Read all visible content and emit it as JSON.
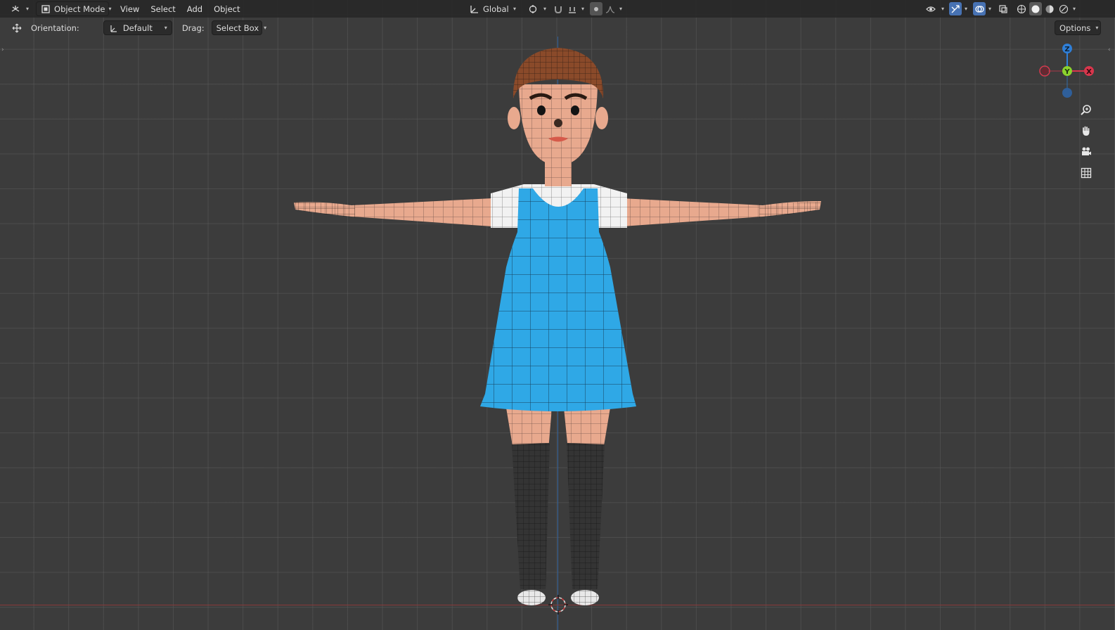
{
  "header": {
    "editor_type_icon": "viewport-editor-icon",
    "mode": "Object Mode",
    "menus": [
      "View",
      "Select",
      "Add",
      "Object"
    ],
    "transform_orientation": "Global",
    "pivot_icon": "pivot-point-icon",
    "snap_icon": "snap-magnet-icon",
    "proportional_icon": "proportional-edit-icon",
    "visibility_icon": "eye-visibility-icon",
    "gizmo_toggle_icon": "gizmo-toggle-icon",
    "overlay_icon": "overlay-icon",
    "xray_icon": "xray-toggle-icon",
    "shading_modes": [
      "wireframe",
      "solid",
      "material",
      "rendered"
    ],
    "active_shading": "solid"
  },
  "tool_settings": {
    "orientation_label": "Orientation:",
    "orientation_value": "Default",
    "drag_label": "Drag:",
    "drag_value": "Select Box",
    "options_label": "Options"
  },
  "gizmo": {
    "z_label": "Z",
    "y_label": "Y",
    "x_label": "X",
    "colors": {
      "x": "#d8364c",
      "y": "#8bd32d",
      "z": "#2f7fd8"
    }
  },
  "nav_buttons": [
    "zoom-icon",
    "hand-pan-icon",
    "camera-icon",
    "grid-ortho-icon"
  ],
  "scene": {
    "object": "character-mesh",
    "dress_color": "#2fa8e6",
    "skin_color": "#e8a98e",
    "hair_color": "#8a4a2a",
    "sock_color": "#333333"
  }
}
